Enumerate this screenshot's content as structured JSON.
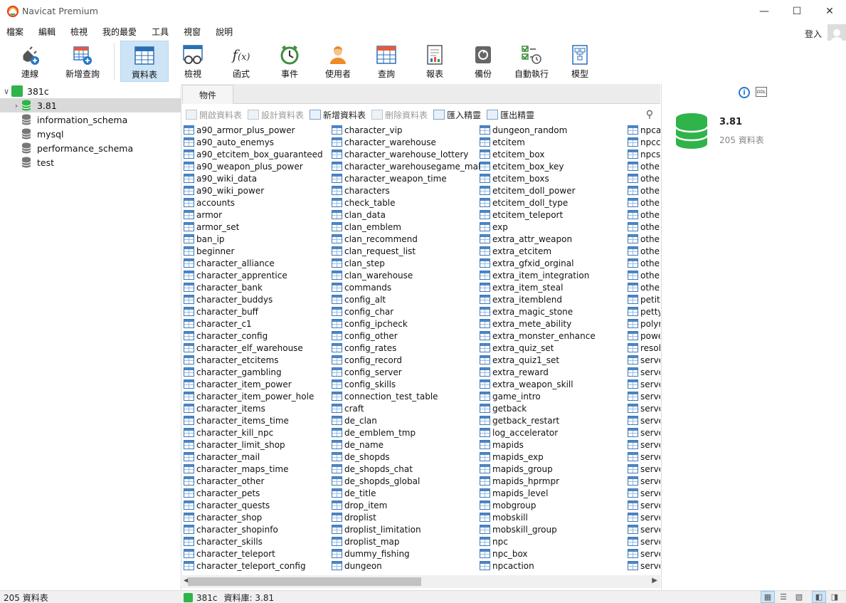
{
  "window": {
    "title": "Navicat Premium"
  },
  "menu": [
    "檔案",
    "編輯",
    "檢視",
    "我的最愛",
    "工具",
    "視窗",
    "說明"
  ],
  "login_label": "登入",
  "toolbar": [
    {
      "label": "連線",
      "icon": "plug-icon"
    },
    {
      "label": "新增查詢",
      "icon": "new-query-icon"
    },
    {
      "label": "資料表",
      "icon": "table-icon",
      "active": true
    },
    {
      "label": "檢視",
      "icon": "view-icon"
    },
    {
      "label": "函式",
      "icon": "function-icon"
    },
    {
      "label": "事件",
      "icon": "clock-icon"
    },
    {
      "label": "使用者",
      "icon": "user-icon"
    },
    {
      "label": "查詢",
      "icon": "query-icon"
    },
    {
      "label": "報表",
      "icon": "report-icon"
    },
    {
      "label": "備份",
      "icon": "backup-icon"
    },
    {
      "label": "自動執行",
      "icon": "schedule-icon"
    },
    {
      "label": "模型",
      "icon": "model-icon"
    }
  ],
  "tree": {
    "connection": "381c",
    "databases": [
      {
        "name": "3.81",
        "selected": true
      },
      {
        "name": "information_schema"
      },
      {
        "name": "mysql"
      },
      {
        "name": "performance_schema"
      },
      {
        "name": "test"
      }
    ]
  },
  "tab_label": "物件",
  "object_toolbar": [
    {
      "label": "開啟資料表",
      "enabled": false
    },
    {
      "label": "設計資料表",
      "enabled": false
    },
    {
      "label": "新增資料表",
      "enabled": true
    },
    {
      "label": "刪除資料表",
      "enabled": false
    },
    {
      "label": "匯入精靈",
      "enabled": true
    },
    {
      "label": "匯出精靈",
      "enabled": true
    }
  ],
  "tables": [
    [
      "a90_armor_plus_power",
      "a90_auto_enemys",
      "a90_etcitem_box_guaranteed",
      "a90_weapon_plus_power",
      "a90_wiki_data",
      "a90_wiki_power",
      "accounts",
      "armor",
      "armor_set",
      "ban_ip",
      "beginner",
      "character_alliance",
      "character_apprentice",
      "character_bank",
      "character_buddys",
      "character_buff",
      "character_c1",
      "character_config",
      "character_elf_warehouse",
      "character_etcitems",
      "character_gambling",
      "character_item_power",
      "character_item_power_hole",
      "character_items",
      "character_items_time",
      "character_kill_npc",
      "character_limit_shop",
      "character_mail",
      "character_maps_time",
      "character_other",
      "character_pets",
      "character_quests",
      "character_shop",
      "character_shopinfo",
      "character_skills",
      "character_teleport",
      "character_teleport_config"
    ],
    [
      "character_vip",
      "character_warehouse",
      "character_warehouse_lottery",
      "character_warehousegame_mall",
      "character_weapon_time",
      "characters",
      "check_table",
      "clan_data",
      "clan_emblem",
      "clan_recommend",
      "clan_request_list",
      "clan_step",
      "clan_warehouse",
      "commands",
      "config_alt",
      "config_char",
      "config_ipcheck",
      "config_other",
      "config_rates",
      "config_record",
      "config_server",
      "config_skills",
      "connection_test_table",
      "craft",
      "de_clan",
      "de_emblem_tmp",
      "de_name",
      "de_shopds",
      "de_shopds_chat",
      "de_shopds_global",
      "de_title",
      "drop_item",
      "droplist",
      "droplist_limitation",
      "droplist_map",
      "dummy_fishing",
      "dungeon"
    ],
    [
      "dungeon_random",
      "etcitem",
      "etcitem_box",
      "etcitem_box_key",
      "etcitem_boxs",
      "etcitem_doll_power",
      "etcitem_doll_type",
      "etcitem_teleport",
      "exp",
      "extra_attr_weapon",
      "extra_etcitem",
      "extra_gfxid_orginal",
      "extra_item_integration",
      "extra_item_steal",
      "extra_itemblend",
      "extra_magic_stone",
      "extra_mete_ability",
      "extra_monster_enhance",
      "extra_quiz_set",
      "extra_quiz1_set",
      "extra_reward",
      "extra_weapon_skill",
      "game_intro",
      "getback",
      "getback_restart",
      "log_accelerator",
      "mapids",
      "mapids_exp",
      "mapids_group",
      "mapids_hprmpr",
      "mapids_level",
      "mobgroup",
      "mobskill",
      "mobskill_group",
      "npc",
      "npc_box",
      "npcaction"
    ],
    [
      "npca",
      "npcc",
      "npcs",
      "other",
      "other",
      "other",
      "other",
      "other",
      "other",
      "other",
      "other",
      "other",
      "other",
      "other",
      "petit",
      "petty",
      "polyr",
      "powe",
      "resol",
      "serve",
      "serve",
      "serve",
      "serve",
      "serve",
      "serve",
      "serve",
      "serve",
      "serve",
      "serve",
      "serve",
      "serve",
      "serve",
      "serve",
      "serve",
      "serve",
      "serve",
      "serve"
    ]
  ],
  "info_panel": {
    "name": "3.81",
    "count": "205 資料表",
    "ddl_label": "DDL"
  },
  "status": {
    "left": "205 資料表",
    "connection": "381c",
    "database": "資料庫: 3.81"
  },
  "colors": {
    "accent": "#cde4f7",
    "db_green": "#2fb34a",
    "table_blue": "#3f78b5"
  }
}
